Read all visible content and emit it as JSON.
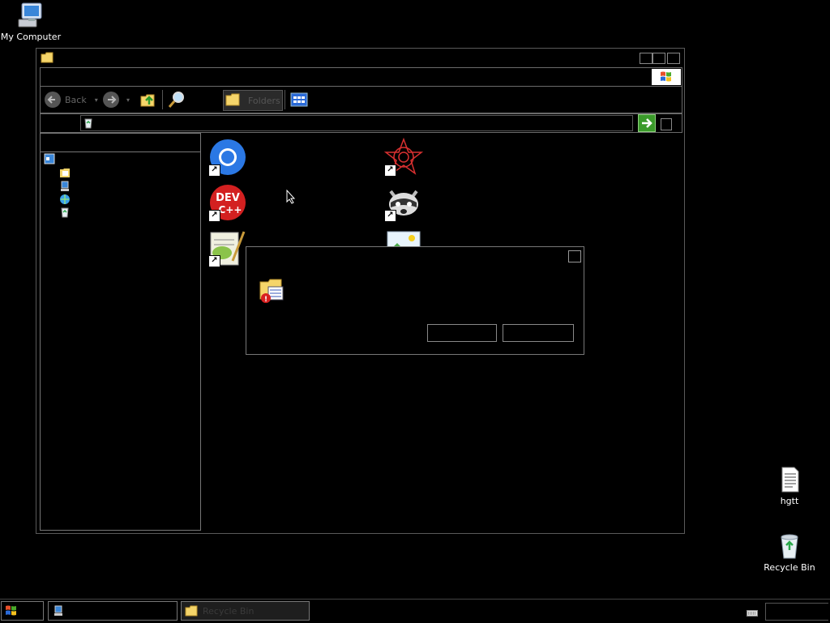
{
  "desktop": {
    "icons": [
      {
        "label": "My Computer",
        "icon": "my-computer-icon"
      },
      {
        "label": "hgtt",
        "icon": "text-document-icon"
      },
      {
        "label": "Recycle Bin",
        "icon": "recycle-bin-icon"
      }
    ]
  },
  "window": {
    "title": "",
    "toolbar": {
      "back_label": "Back",
      "folders_label": "Folders"
    },
    "content_icons": [
      "chrome-icon",
      "dev-cpp-icon",
      "notepad-plus-plus-icon",
      "cyberlink-icon",
      "raccoon-app-icon",
      "photos-icon"
    ]
  },
  "dialog": {
    "icon": "folder-error-icon"
  },
  "taskbar": {
    "start_icon": "windows-flag-icon",
    "tasks": [
      {
        "label": "",
        "icon": "computer-icon"
      },
      {
        "label": "Recycle Bin",
        "icon": "folder-icon"
      }
    ],
    "tray_icon": "keyboard-icon"
  },
  "colors": {
    "go_green": "#3a9a2a",
    "chrome_blue": "#2b78e4",
    "dev_red": "#d32020"
  }
}
